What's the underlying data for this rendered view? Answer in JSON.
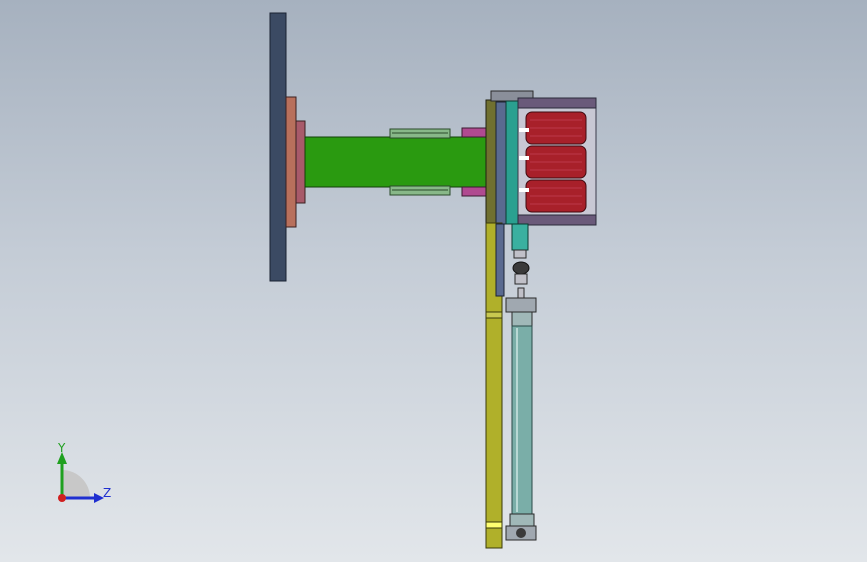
{
  "viewport": {
    "background_top": "#a6b1bf",
    "background_bottom": "#e2e6ea"
  },
  "triad": {
    "y_label": "Y",
    "z_label": "Z",
    "y_color": "#1fa01f",
    "z_color": "#1f2fd0",
    "x_color": "#d01f1f"
  },
  "colors": {
    "mount_plate": "#3b4a63",
    "flange": "#b8705c",
    "flange_inner": "#a85a6a",
    "arm": "#2a9a10",
    "clamp": "#5a9a5a",
    "clamp_pink": "#b04a90",
    "olive_plate": "#707030",
    "blue_plate": "#5a6a90",
    "teal_block": "#2aa090",
    "magnet_red": "#a8202a",
    "frame": "#6a5a7a",
    "hang_bar": "#b0b02a",
    "rod": "#7aaea8"
  }
}
